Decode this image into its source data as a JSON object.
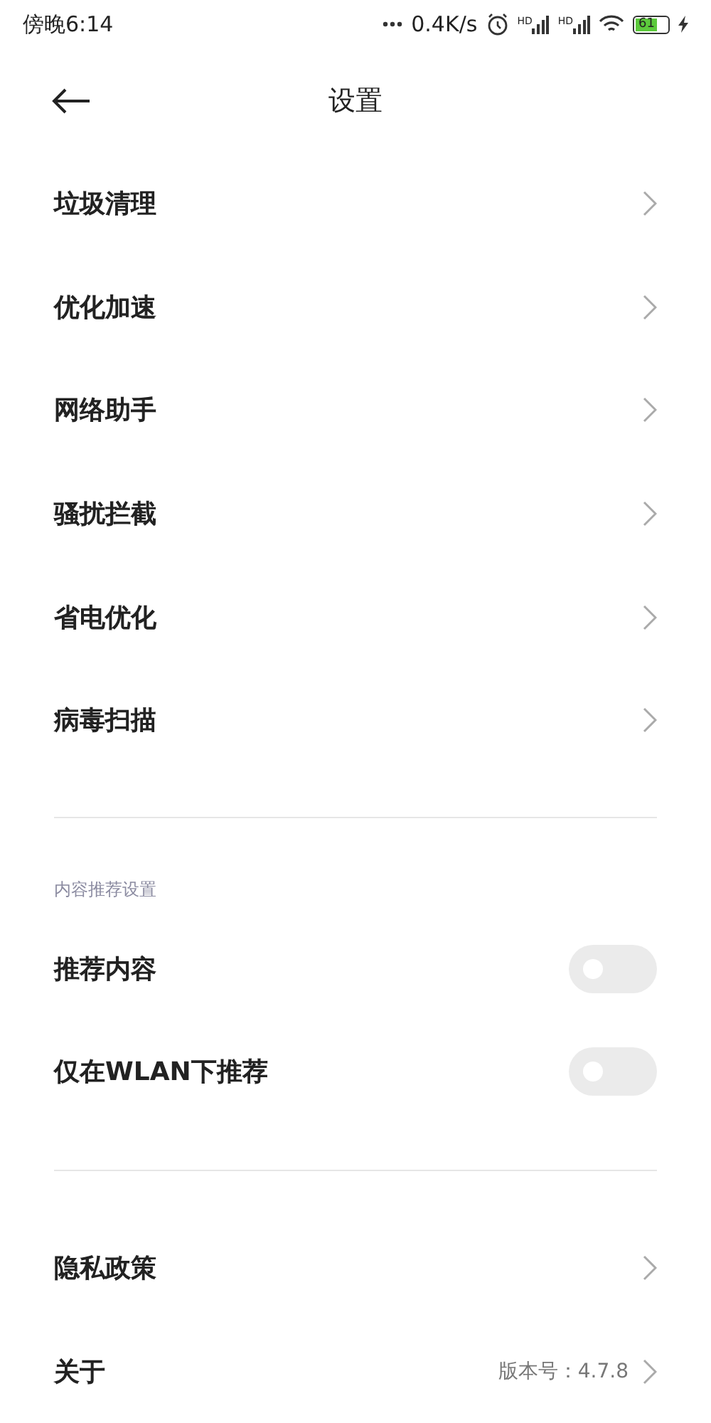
{
  "status_bar": {
    "time": "傍晚6:14",
    "speed": "0.4K/s",
    "signal_badges": [
      "HD",
      "HD"
    ],
    "battery": "61",
    "charging": true
  },
  "header": {
    "title": "设置"
  },
  "menu": [
    {
      "label": "垃圾清理"
    },
    {
      "label": "优化加速"
    },
    {
      "label": "网络助手"
    },
    {
      "label": "骚扰拦截"
    },
    {
      "label": "省电优化"
    },
    {
      "label": "病毒扫描"
    }
  ],
  "recommend": {
    "heading": "内容推荐设置",
    "toggles": [
      {
        "label": "推荐内容",
        "on": false
      },
      {
        "label": "仅在WLAN下推荐",
        "on": false
      }
    ]
  },
  "about": [
    {
      "label": "隐私政策"
    },
    {
      "label": "关于",
      "value": "版本号：4.7.8"
    }
  ]
}
